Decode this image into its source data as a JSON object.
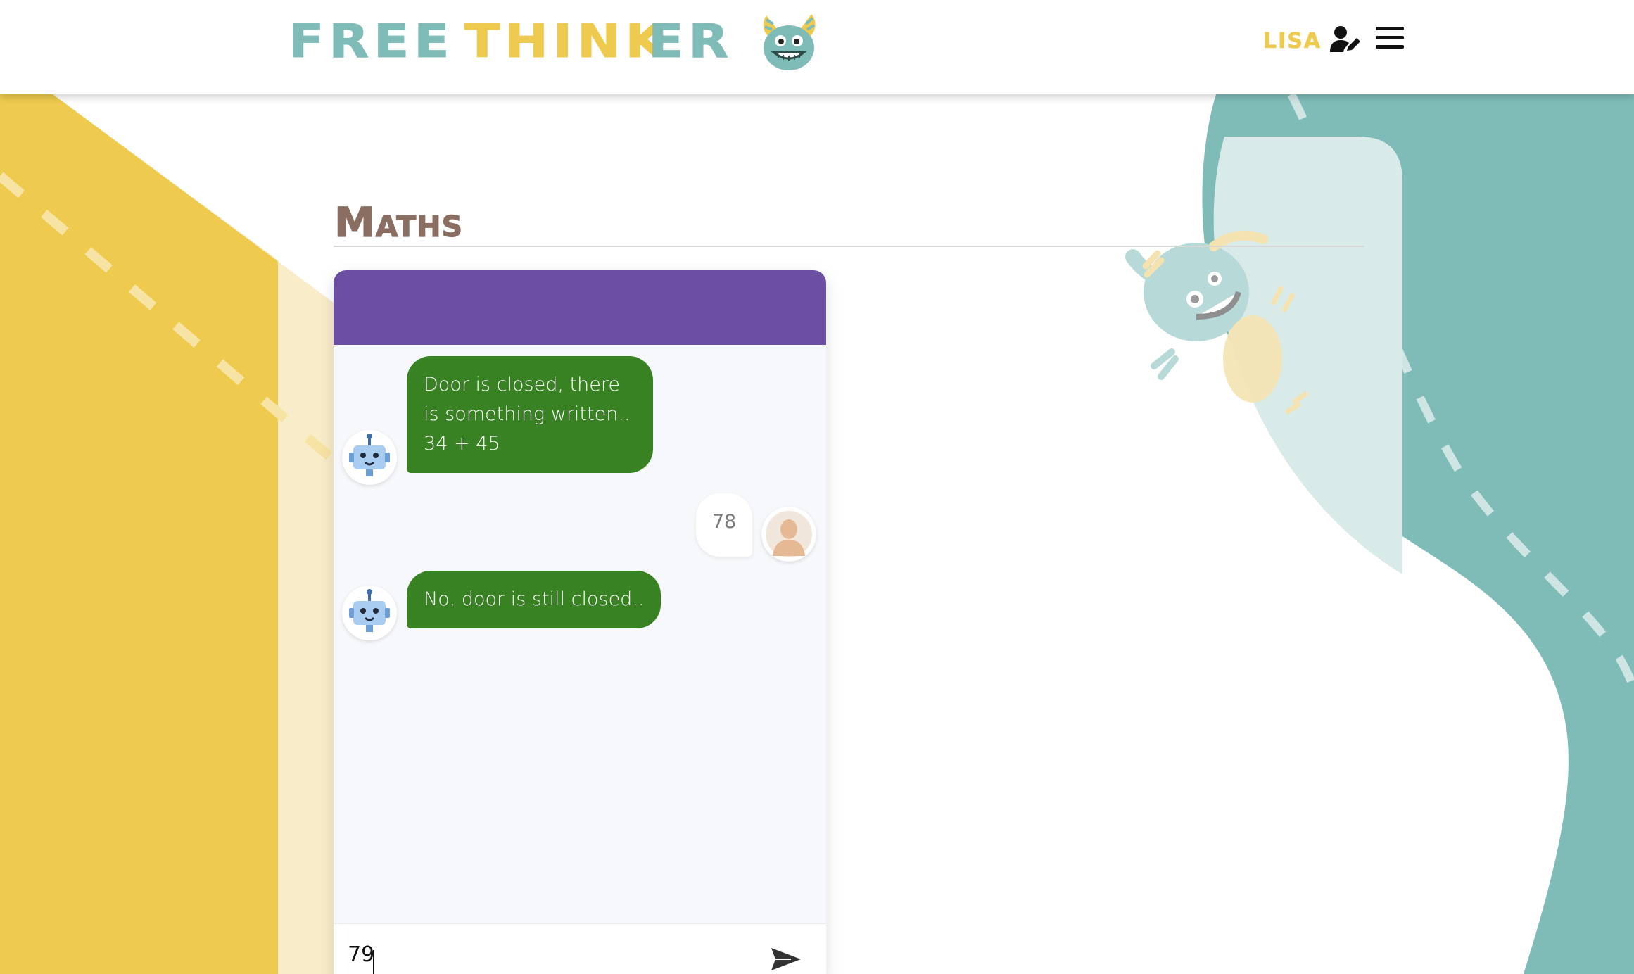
{
  "brand": {
    "word1": "FREE",
    "word2": "THINK",
    "word3": "ER",
    "mascot_icon": "monster-face-icon"
  },
  "header": {
    "user_name": "LISA",
    "user_icon": "user-edit-icon",
    "menu_icon": "hamburger-menu-icon"
  },
  "page": {
    "title": "Maths"
  },
  "chat": {
    "messages": [
      {
        "from": "bot",
        "text": "Door is closed, there is something written.. 34 + 45"
      },
      {
        "from": "user",
        "text": "78"
      },
      {
        "from": "bot",
        "text": "No, door is still closed.."
      }
    ],
    "input_value": "79",
    "send_icon": "send-icon"
  },
  "colors": {
    "brand_teal": "#7fbcb8",
    "brand_yellow": "#eecb4e",
    "title_brown": "#8a6e62",
    "chat_header_purple": "#6a4fa3",
    "bot_bubble_green": "#388223"
  }
}
